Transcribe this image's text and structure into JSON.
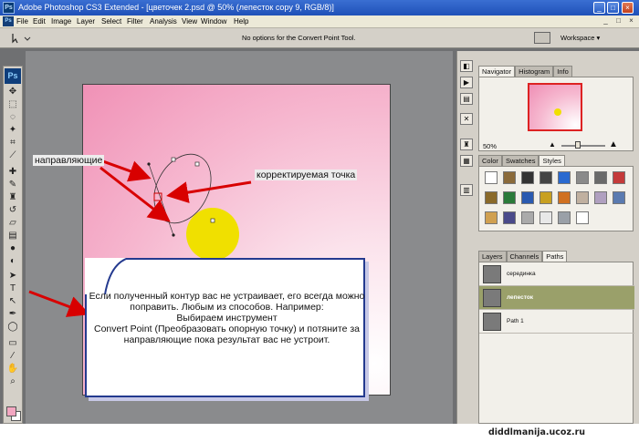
{
  "window": {
    "app_badge": "Ps",
    "title": "Adobe Photoshop CS3 Extended - [цветочек 2.psd @ 50% (лепесток copy 9, RGB/8)]",
    "minimize": "_",
    "maximize": "□",
    "close": "×"
  },
  "menubar": {
    "items": [
      "File",
      "Edit",
      "Image",
      "Layer",
      "Select",
      "Filter",
      "Analysis",
      "View",
      "Window",
      "Help"
    ],
    "doc_controls": [
      "_",
      "□",
      "×"
    ]
  },
  "optionsbar": {
    "tool_icon": "convert-point-icon",
    "message": "No options for the Convert Point Tool.",
    "workspace_label": "Workspace ▾"
  },
  "toolbox": {
    "logo": "Ps",
    "tools": [
      "move",
      "marquee",
      "lasso",
      "magic-wand",
      "crop",
      "slice",
      "healing",
      "brush",
      "clone",
      "history-brush",
      "eraser",
      "gradient",
      "blur",
      "dodge",
      "path-selection",
      "type",
      "direct-selection",
      "pen",
      "shape",
      "notes",
      "eyedropper",
      "hand",
      "zoom"
    ],
    "foreground_color": "#f3a7c1",
    "background_color": "#ffffff"
  },
  "navigator_panel": {
    "tabs": [
      "Navigator",
      "Histogram",
      "Info"
    ],
    "active_tab": "Navigator",
    "zoom": "50%"
  },
  "styles_panel": {
    "tabs": [
      "Color",
      "Swatches",
      "Styles"
    ],
    "active_tab": "Styles",
    "style_colors": [
      "#ffffff",
      "#8a6a3a",
      "#333333",
      "#444444",
      "#2a6ad0",
      "#8a8a8a",
      "#6a6a6a",
      "#c43a3a",
      "#8a6a2a",
      "#2a7a3a",
      "#2a5ab0",
      "#c8a020",
      "#d07020",
      "#c0b0a0",
      "#b0a0c0",
      "#5a7ab0",
      "#d0a050",
      "#4a4a8a",
      "#aaaaaa",
      "#e8e8e8",
      "#9aa0a8",
      "#ffffff"
    ]
  },
  "paths_panel": {
    "tabs": [
      "Layers",
      "Channels",
      "Paths"
    ],
    "active_tab": "Paths",
    "paths": [
      {
        "name": "серединка",
        "selected": false
      },
      {
        "name": "лепесток",
        "selected": true
      },
      {
        "name": "Path 1",
        "selected": false
      }
    ]
  },
  "annotations": {
    "guides_label": "направляющие",
    "point_label": "корректируемая точка",
    "note_text": "Если полученный контур вас не устраивает, его всегда можно поправить. Любым из способов. Например:\nВыбираем инструмент\nConvert Point (Преобразовать опорную точку) и потяните за направляющие пока результат вас не устроит."
  },
  "watermark": "diddlmanija.ucoz.ru",
  "colors": {
    "arrow": "#d80000",
    "sun": "#f0e000",
    "note_border": "#243a8f",
    "canvas_pink": "#f091b6"
  }
}
